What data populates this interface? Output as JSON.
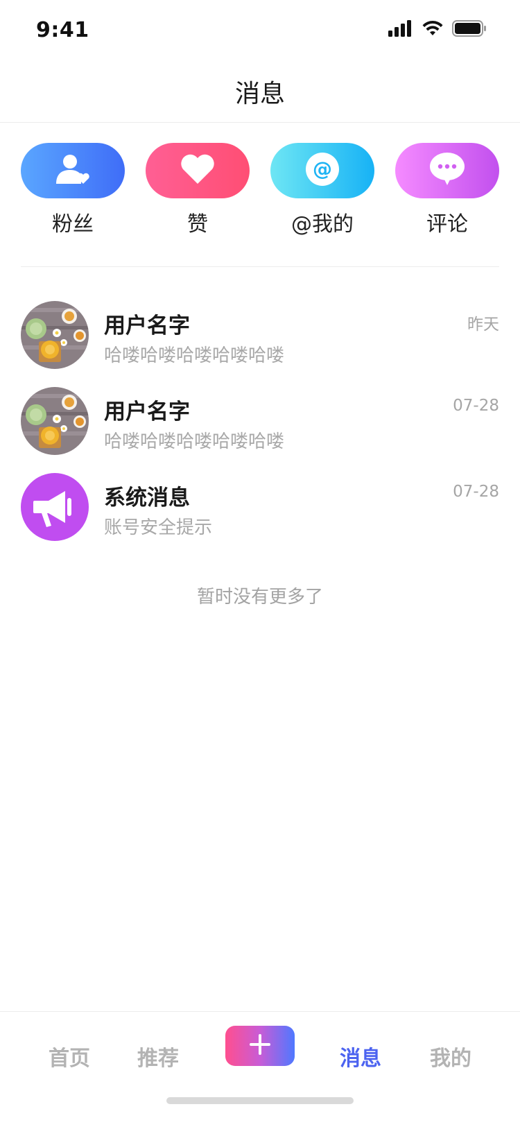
{
  "status_bar": {
    "time": "9:41"
  },
  "header": {
    "title": "消息"
  },
  "quick_actions": [
    {
      "label": "粉丝",
      "icon": "user-heart-icon",
      "colors": [
        "#5aa6ff",
        "#3f6df7"
      ]
    },
    {
      "label": "赞",
      "icon": "heart-icon",
      "colors": [
        "#ff5f94",
        "#ff4e74"
      ]
    },
    {
      "label": "@我的",
      "icon": "at-sign-icon",
      "colors": [
        "#6ee6f4",
        "#17b2f5"
      ]
    },
    {
      "label": "评论",
      "icon": "chat-bubble-icon",
      "colors": [
        "#f58bff",
        "#c250ee"
      ]
    }
  ],
  "messages": [
    {
      "name": "用户名字",
      "time": "昨天",
      "preview": "哈喽哈喽哈喽哈喽哈喽",
      "avatar": "food-photo-avatar"
    },
    {
      "name": "用户名字",
      "time": "07-28",
      "preview": "哈喽哈喽哈喽哈喽哈喽",
      "avatar": "food-photo-avatar"
    },
    {
      "name": "系统消息",
      "time": "07-28",
      "preview": "账号安全提示",
      "avatar": "megaphone-icon"
    }
  ],
  "list_footer": "暂时没有更多了",
  "tab_bar": {
    "items": [
      {
        "label": "首页",
        "active": false
      },
      {
        "label": "推荐",
        "active": false
      },
      {
        "label": "消息",
        "active": true
      },
      {
        "label": "我的",
        "active": false
      }
    ],
    "plus_icon": "plus-icon"
  },
  "colors": {
    "accent": "#4c63f0",
    "system_avatar": "#c04df0"
  }
}
